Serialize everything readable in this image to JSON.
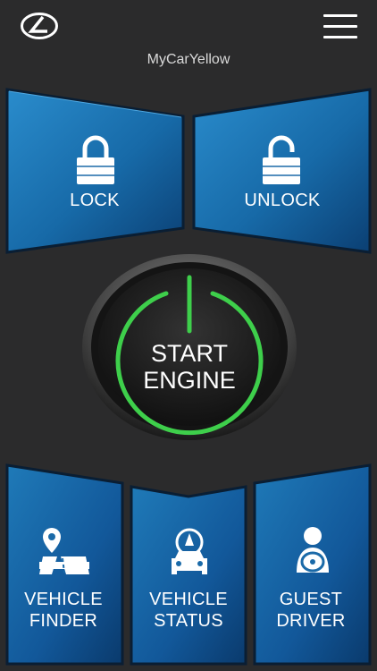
{
  "header": {
    "logo_icon": "lexus-logo",
    "menu_icon": "hamburger-menu-icon",
    "vehicle_name": "MyCarYellow"
  },
  "controls": {
    "lock": {
      "label": "LOCK",
      "icon": "padlock-locked-icon"
    },
    "unlock": {
      "label": "UNLOCK",
      "icon": "padlock-unlocked-icon"
    },
    "start_engine": {
      "line1": "START",
      "line2": "ENGINE",
      "icon": "power-icon"
    }
  },
  "tiles": {
    "vehicle_finder": {
      "line1": "VEHICLE",
      "line2": "FINDER",
      "icon": "map-pin-road-icon"
    },
    "vehicle_status": {
      "line1": "VEHICLE",
      "line2": "STATUS",
      "icon": "car-status-icon"
    },
    "guest_driver": {
      "line1": "GUEST",
      "line2": "DRIVER",
      "icon": "guest-driver-icon"
    }
  },
  "colors": {
    "background": "#2b2b2c",
    "tile_blue_light": "#1f7ab8",
    "tile_blue_dark": "#0b3f73",
    "engine_ring_green": "#3ecf4b"
  }
}
